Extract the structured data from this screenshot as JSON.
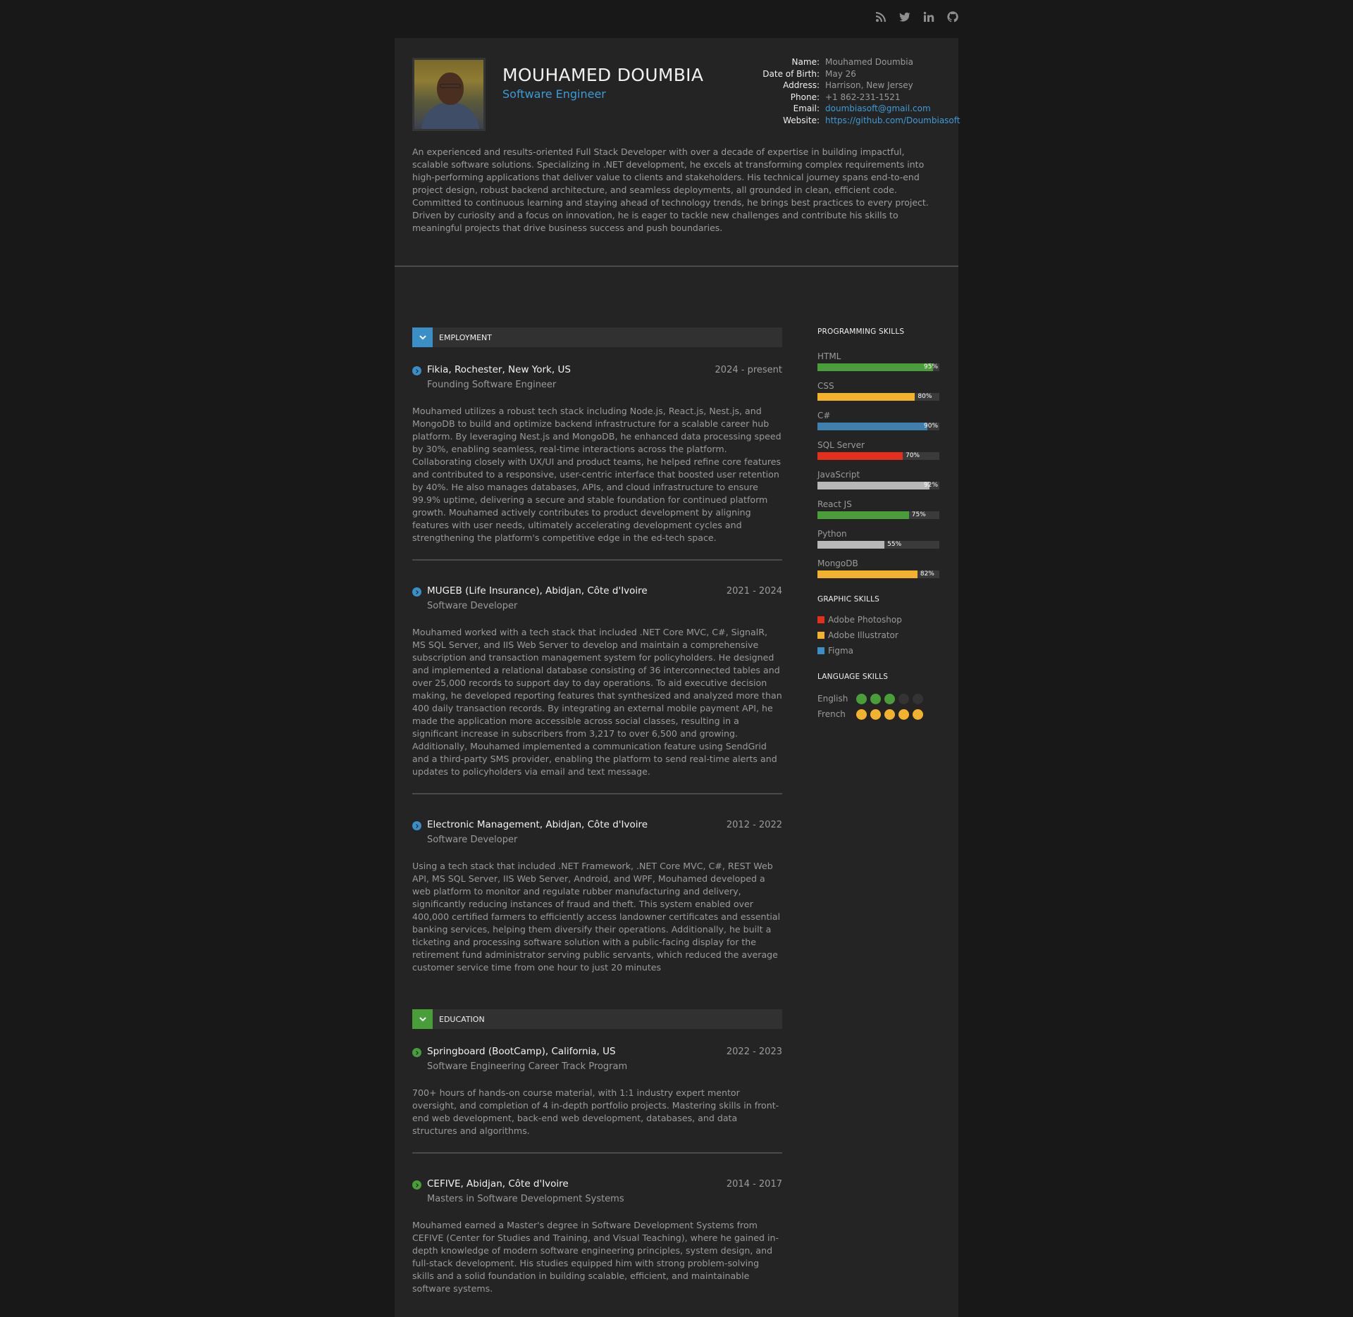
{
  "social": [
    {
      "icon": "rss-icon"
    },
    {
      "icon": "twitter-icon"
    },
    {
      "icon": "linkedin-icon"
    },
    {
      "icon": "github-icon"
    }
  ],
  "profile": {
    "name": "MOUHAMED DOUMBIA",
    "role": "Software Engineer",
    "info": [
      {
        "key": "Name:",
        "value": "Mouhamed Doumbia",
        "link": false
      },
      {
        "key": "Date of Birth:",
        "value": "May 26",
        "link": false
      },
      {
        "key": "Address:",
        "value": "Harrison, New Jersey",
        "link": false
      },
      {
        "key": "Phone:",
        "value": "+1 862-231-1521",
        "link": false
      },
      {
        "key": "Email:",
        "value": "doumbiasoft@gmail.com",
        "link": true
      },
      {
        "key": "Website:",
        "value": "https://github.com/Doumbiasoft",
        "link": true
      }
    ],
    "summary": "An experienced and results-oriented Full Stack Developer with over a decade of expertise in building impactful, scalable software solutions. Specializing in .NET development, he excels at transforming complex requirements into high-performing applications that deliver value to clients and stakeholders. His technical journey spans end-to-end project design, robust backend architecture, and seamless deployments, all grounded in clean, efficient code. Committed to continuous learning and staying ahead of technology trends, he brings best practices to every project. Driven by curiosity and a focus on innovation, he is eager to tackle new challenges and contribute his skills to meaningful projects that drive business success and push boundaries."
  },
  "sections": [
    {
      "title": "EMPLOYMENT",
      "color": "#3a8fc7",
      "entries": [
        {
          "org": "Fikia, Rochester, New York, US",
          "date": "2024 - present",
          "position": "Founding Software Engineer",
          "desc": "Mouhamed utilizes a robust tech stack including Node.js, React.js, Nest.js, and MongoDB to build and optimize backend infrastructure for a scalable career hub platform. By leveraging Nest.js and MongoDB, he enhanced data processing speed by 30%, enabling seamless, real-time interactions across the platform. Collaborating closely with UX/UI and product teams, he helped refine core features and contributed to a responsive, user-centric interface that boosted user retention by 40%. He also manages databases, APIs, and cloud infrastructure to ensure 99.9% uptime, delivering a secure and stable foundation for continued platform growth. Mouhamed actively contributes to product development by aligning features with user needs, ultimately accelerating development cycles and strengthening the platform's competitive edge in the ed-tech space."
        },
        {
          "org": "MUGEB (Life Insurance), Abidjan, Côte d'Ivoire",
          "date": "2021 - 2024",
          "position": "Software Developer",
          "desc": "Mouhamed worked with a tech stack that included .NET Core MVC, C#, SignalR, MS SQL Server, and IIS Web Server to develop and maintain a comprehensive subscription and transaction management system for policyholders. He designed and implemented a relational database consisting of 36 interconnected tables and over 25,000 records to support day to day operations. To aid executive decision making, he developed reporting features that synthesized and analyzed more than 400 daily transaction records. By integrating an external mobile payment API, he made the application more accessible across social classes, resulting in a significant increase in subscribers from 3,217 to over 6,500 and growing. Additionally, Mouhamed implemented a communication feature using SendGrid and a third-party SMS provider, enabling the platform to send real-time alerts and updates to policyholders via email and text message."
        },
        {
          "org": "Electronic Management, Abidjan, Côte d'Ivoire",
          "date": "2012 - 2022",
          "position": "Software Developer",
          "desc": "Using a tech stack that included .NET Framework, .NET Core MVC, C#, REST Web API, MS SQL Server, IIS Web Server, Android, and WPF, Mouhamed developed a web platform to monitor and regulate rubber manufacturing and delivery, significantly reducing instances of fraud and theft. This system enabled over 400,000 certified farmers to efficiently access landowner certificates and essential banking services, helping them diversify their operations. Additionally, he built a ticketing and processing software solution with a public-facing display for the retirement fund administrator serving public servants, which reduced the average customer service time from one hour to just 20 minutes"
        }
      ]
    },
    {
      "title": "EDUCATION",
      "color": "#4a9e3a",
      "entries": [
        {
          "org": "Springboard (BootCamp), California, US",
          "date": "2022 - 2023",
          "position": "Software Engineering Career Track Program",
          "desc": "700+ hours of hands-on course material, with 1:1 industry expert mentor oversight, and completion of 4 in-depth portfolio projects. Mastering skills in front-end web development, back-end web development, databases, and data structures and algorithms."
        },
        {
          "org": "CEFIVE, Abidjan, Côte d'Ivoire",
          "date": "2014 - 2017",
          "position": "Masters in Software Development Systems",
          "desc": "Mouhamed earned a Master's degree in Software Development Systems from CEFIVE (Center for Studies and Training, and Visual Teaching), where he gained in-depth knowledge of modern software engineering principles, system design, and full-stack development. His studies equipped him with strong problem-solving skills and a solid foundation in building scalable, efficient, and maintainable software systems."
        }
      ]
    }
  ],
  "sidebar": {
    "programming_title": "PROGRAMMING SKILLS",
    "programming": [
      {
        "name": "HTML",
        "pct": 95,
        "label": "95%",
        "color": "#4a9e3a"
      },
      {
        "name": "CSS",
        "pct": 80,
        "label": "80%",
        "color": "#f3b22e"
      },
      {
        "name": "C#",
        "pct": 90,
        "label": "90%",
        "color": "#3f7fad"
      },
      {
        "name": "SQL Server",
        "pct": 70,
        "label": "70%",
        "color": "#e3301d"
      },
      {
        "name": "JavaScript",
        "pct": 92,
        "label": "92%",
        "color": "#b8b8b8"
      },
      {
        "name": "React JS",
        "pct": 75,
        "label": "75%",
        "color": "#4a9e3a"
      },
      {
        "name": "Python",
        "pct": 55,
        "label": "55%",
        "color": "#b8b8b8"
      },
      {
        "name": "MongoDB",
        "pct": 82,
        "label": "82%",
        "color": "#f3b22e"
      }
    ],
    "graphic_title": "GRAPHIC SKILLS",
    "graphic": [
      {
        "name": "Adobe Photoshop",
        "color": "#e3301d"
      },
      {
        "name": "Adobe Illustrator",
        "color": "#f3b22e"
      },
      {
        "name": "Figma",
        "color": "#3a8fc7"
      }
    ],
    "language_title": "LANGUAGE SKILLS",
    "languages": [
      {
        "name": "English",
        "level": 3,
        "max": 5,
        "color": "#4a9e3a"
      },
      {
        "name": "French",
        "level": 5,
        "max": 5,
        "color": "#f3b22e"
      }
    ]
  }
}
